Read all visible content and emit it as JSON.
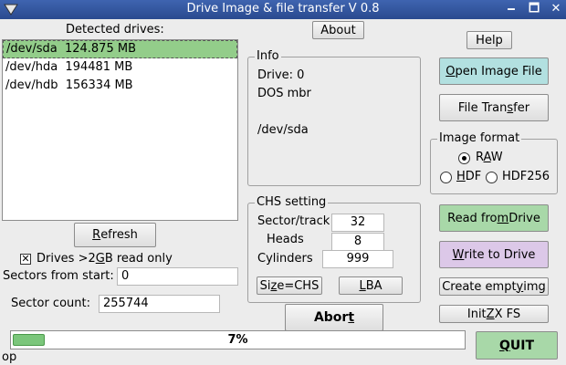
{
  "window": {
    "title": "Drive Image & file transfer V 0.8",
    "minimize_glyph": "🗕",
    "maximize_glyph": "🗖",
    "close_glyph": "✕"
  },
  "drives": {
    "heading": "Detected drives:",
    "items": [
      {
        "label": "/dev/sda  124.875 MB",
        "selected": true
      },
      {
        "label": "/dev/hda  194481 MB",
        "selected": false
      },
      {
        "label": "/dev/hdb  156334 MB",
        "selected": false
      }
    ],
    "refresh": {
      "pre": "",
      "u": "R",
      "post": "efresh"
    }
  },
  "options": {
    "read_only": {
      "pre": "Drives >2",
      "u": "G",
      "post": "B read only",
      "checked": true,
      "check_glyph": "✕"
    },
    "sectors_from_start_label": "Sectors from start:",
    "sectors_from_start_value": "0",
    "sector_count_label": "Sector count:",
    "sector_count_value": "255744"
  },
  "about": {
    "label": "About"
  },
  "help": {
    "label": "Help"
  },
  "info": {
    "legend": "Info",
    "lines": [
      "Drive: 0",
      "DOS mbr",
      "",
      "/dev/sda"
    ]
  },
  "chs": {
    "legend": "CHS setting",
    "sectors_label": "Sector/track",
    "sectors_value": "32",
    "heads_label": "Heads",
    "heads_value": "8",
    "cylinders_label": "Cylinders",
    "cylinders_value": "999",
    "size_btn": {
      "pre": "Si",
      "u": "z",
      "post": "e=CHS"
    },
    "lba_btn": {
      "pre": "",
      "u": "L",
      "post": "BA"
    }
  },
  "abort": {
    "pre": "Abor",
    "u": "t",
    "post": ""
  },
  "actions": {
    "open_image": {
      "pre": "",
      "u": "O",
      "post": "pen Image File"
    },
    "file_transfer": {
      "pre": "File Tran",
      "u": "s",
      "post": "fer"
    },
    "read_drive": {
      "pre": "Read fro",
      "u": "m",
      "post": " Drive"
    },
    "write_drive": {
      "pre": "",
      "u": "W",
      "post": "rite to Drive"
    },
    "create_empty": {
      "pre": "Create empt",
      "u": "y",
      "post": " img"
    },
    "init_zx": {
      "pre": "Init ",
      "u": "Z",
      "post": "X FS"
    },
    "quit": {
      "pre": "",
      "u": "Q",
      "post": "UIT"
    }
  },
  "image_format": {
    "legend": "Image format",
    "options": [
      {
        "pre": "R",
        "u": "A",
        "post": "W",
        "selected": true
      },
      {
        "pre": "",
        "u": "H",
        "post": "DF",
        "selected": false
      },
      {
        "pre": "HDF256",
        "u": "",
        "post": "",
        "selected": false
      }
    ]
  },
  "progress": {
    "percent": 7,
    "label": "7%"
  },
  "status": {
    "text": "op"
  },
  "colors": {
    "titlebar": "#2f55a4",
    "selected_row": "#93cd8a",
    "progress_fill": "#7bc67b"
  }
}
